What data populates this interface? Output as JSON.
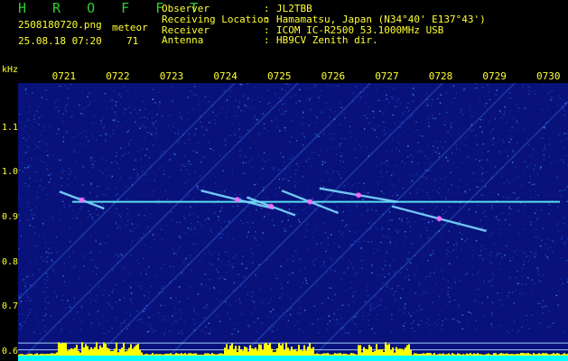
{
  "header": {
    "brand": "H R O F F T",
    "filename": "2508180720.png",
    "datetime": "25.08.18 07:20",
    "meteor_label": "meteor",
    "meteor_count": "71"
  },
  "station": [
    {
      "key": "Observer",
      "value": "JL2TBB"
    },
    {
      "key": "Receiving Location",
      "value": "Hamamatsu, Japan (N34°40' E137°43')"
    },
    {
      "key": "Receiver",
      "value": "ICOM IC-R2500 53.1000MHz USB"
    },
    {
      "key": "Antenna",
      "value": "HB9CV Zenith dir."
    }
  ],
  "colors": {
    "text": "#ffff33",
    "brand": "#33cc33",
    "background": "#08127a",
    "echo": "#ff66ff",
    "carrier": "#66ffff",
    "level_fill": "#00ffff",
    "level_peak": "#ffff00"
  },
  "chart_data": {
    "type": "heatmap",
    "x_ticks": [
      "0721",
      "0722",
      "0723",
      "0724",
      "0725",
      "0726",
      "0727",
      "0728",
      "0729",
      "0730"
    ],
    "x_range": [
      "0720",
      "0730"
    ],
    "y_unit": "kHz",
    "y_ticks": [
      "1.1",
      "1.0",
      "0.9",
      "0.8",
      "0.7",
      "0.6"
    ],
    "y_range": [
      0.58,
      1.2
    ],
    "carrier_freq_khz": 0.935,
    "echoes": [
      {
        "t0": 0.77,
        "f0": 0.958,
        "t1": 1.6,
        "f1": 0.92
      },
      {
        "t0": 3.4,
        "f0": 0.96,
        "t1": 4.75,
        "f1": 0.92
      },
      {
        "t0": 4.25,
        "f0": 0.945,
        "t1": 5.15,
        "f1": 0.905
      },
      {
        "t0": 4.9,
        "f0": 0.96,
        "t1": 5.95,
        "f1": 0.91
      },
      {
        "t0": 5.6,
        "f0": 0.965,
        "t1": 7.05,
        "f1": 0.935
      },
      {
        "t0": 6.95,
        "f0": 0.925,
        "t1": 8.7,
        "f1": 0.87
      }
    ]
  }
}
